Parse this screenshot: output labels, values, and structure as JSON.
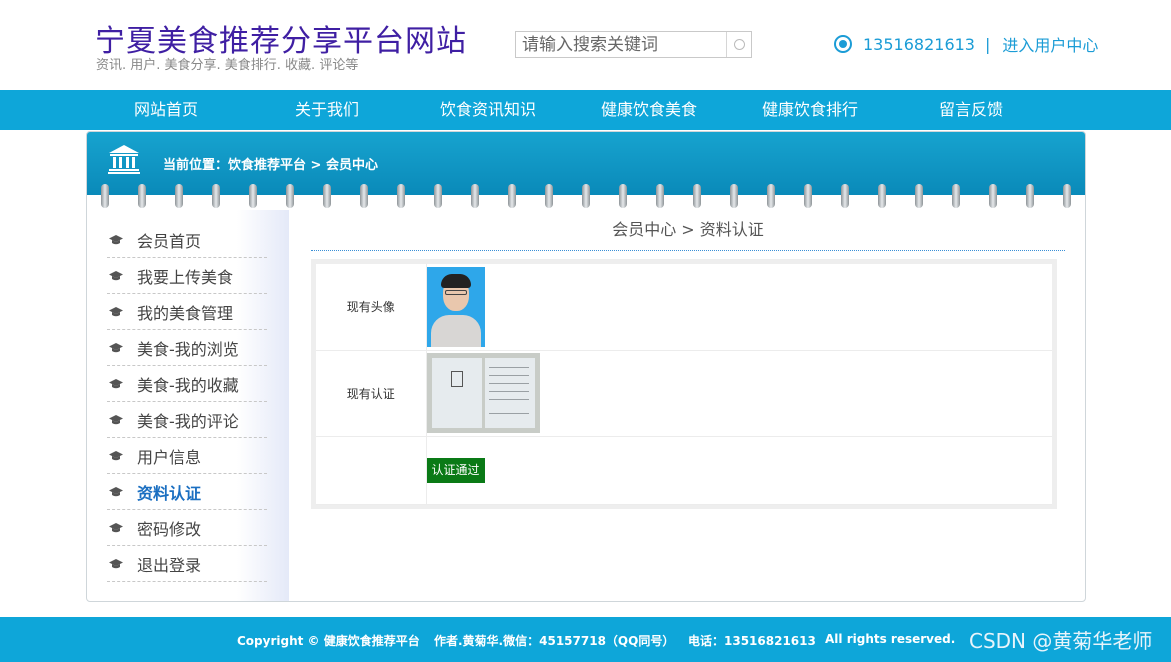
{
  "header": {
    "site_title": "宁夏美食推荐分享平台网站",
    "site_subtitle": "资讯. 用户. 美食分享. 美食排行. 收藏. 评论等",
    "search_placeholder": "请输入搜索关键词",
    "phone": "13516821613",
    "separator": "|",
    "user_center_link": "进入用户中心"
  },
  "nav": {
    "items": [
      {
        "label": "网站首页"
      },
      {
        "label": "关于我们"
      },
      {
        "label": "饮食资讯知识"
      },
      {
        "label": "健康饮食美食"
      },
      {
        "label": "健康饮食排行"
      },
      {
        "label": "留言反馈"
      }
    ]
  },
  "breadcrumb": {
    "text": "当前位置：饮食推荐平台 > 会员中心"
  },
  "sidebar": {
    "active_index": 7,
    "items": [
      {
        "label": "会员首页"
      },
      {
        "label": "我要上传美食"
      },
      {
        "label": "我的美食管理"
      },
      {
        "label": "美食-我的浏览"
      },
      {
        "label": "美食-我的收藏"
      },
      {
        "label": "美食-我的评论"
      },
      {
        "label": "用户信息"
      },
      {
        "label": "资料认证"
      },
      {
        "label": "密码修改"
      },
      {
        "label": "退出登录"
      }
    ]
  },
  "content": {
    "title": "会员中心 > 资料认证",
    "rows": {
      "avatar_label": "现有头像",
      "cert_label": "现有认证",
      "status_label": "",
      "status_badge": "认证通过"
    }
  },
  "footer": {
    "copyright": "Copyright © 健康饮食推荐平台",
    "author": "作者.黄菊华.微信：45157718（QQ同号）",
    "phone": "电话：13516821613",
    "rights": "All rights reserved.",
    "watermark": "CSDN @黄菊华老师"
  },
  "colors": {
    "brand_blue": "#0ea6d9",
    "title_purple": "#3f1fa3",
    "link_blue": "#1b9cd6",
    "active_blue": "#1b6fc1",
    "badge_green": "#0a7a16"
  },
  "icons": {
    "location": "target-icon",
    "search": "magnifier-icon",
    "breadcrumb": "bank-building-icon",
    "sidebar": "graduation-cap-icon"
  }
}
